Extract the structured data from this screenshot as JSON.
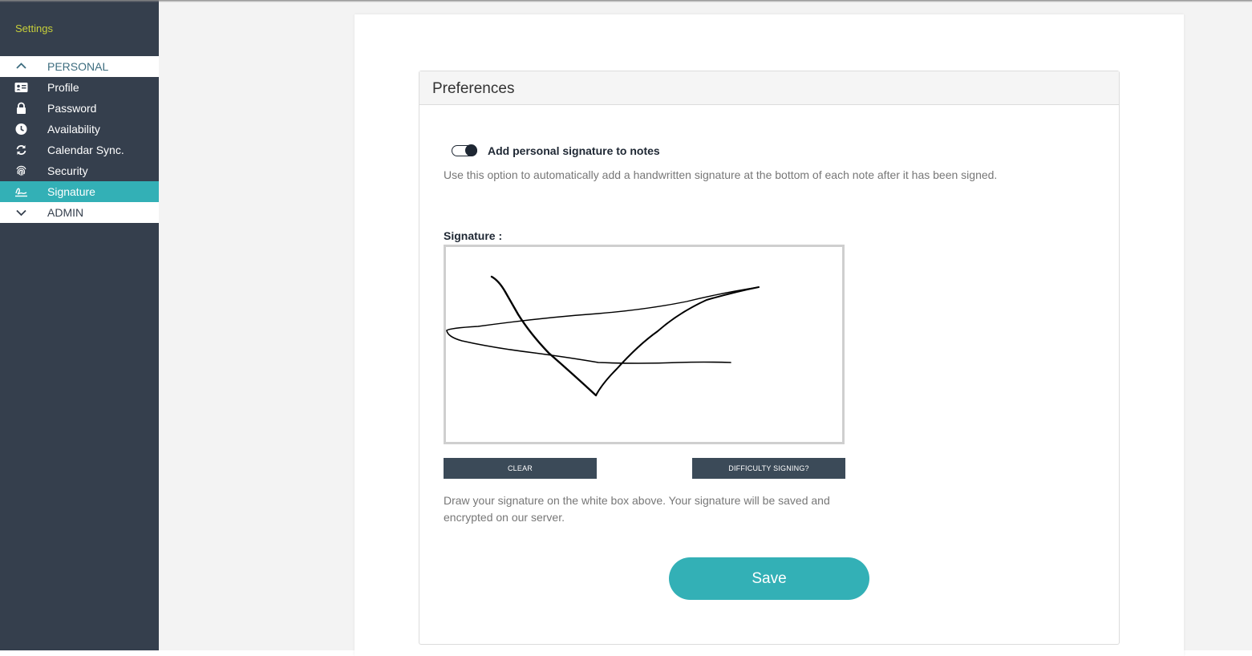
{
  "sidebar": {
    "title": "Settings",
    "sections": {
      "personal": "PERSONAL",
      "admin": "ADMIN"
    },
    "items": [
      {
        "label": "Profile",
        "icon": "id-card-icon"
      },
      {
        "label": "Password",
        "icon": "lock-icon"
      },
      {
        "label": "Availability",
        "icon": "clock-icon"
      },
      {
        "label": "Calendar Sync.",
        "icon": "sync-icon"
      },
      {
        "label": "Security",
        "icon": "fingerprint-icon"
      },
      {
        "label": "Signature",
        "icon": "signature-icon",
        "active": true
      }
    ]
  },
  "panel": {
    "title": "Preferences",
    "toggle_label": "Add personal signature to notes",
    "toggle_on": true,
    "description": "Use this option to automatically add a handwritten signature at the bottom of each note after it has been signed.",
    "signature_label": "Signature :",
    "clear_button": "CLEAR",
    "difficulty_button": "DIFFICULTY SIGNING?",
    "help_text": "Draw your signature on the white box above. Your signature will be saved and encrypted on our server.",
    "save_button": "Save"
  },
  "colors": {
    "sidebar_bg": "#353f4d",
    "accent": "#33b0b6",
    "title_yellow": "#c7cf3a",
    "dark_button": "#3b4a58"
  }
}
